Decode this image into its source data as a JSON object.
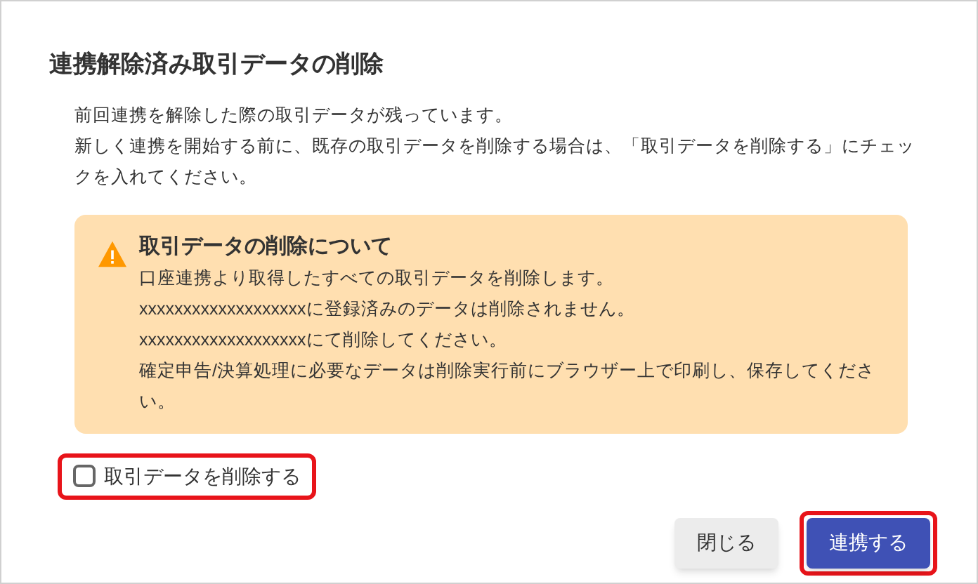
{
  "dialog": {
    "title": "連携解除済み取引データの削除",
    "message": [
      "前回連携を解除した際の取引データが残っています。",
      "新しく連携を開始する前に、既存の取引データを削除する場合は、「取引データを削除する」にチェックを入れてください。"
    ],
    "alert": {
      "title": "取引データの削除について",
      "lines": [
        "口座連携より取得したすべての取引データを削除します。",
        "xxxxxxxxxxxxxxxxxxxに登録済みのデータは削除されません。",
        "xxxxxxxxxxxxxxxxxxxにて削除してください。",
        "確定申告/決算処理に必要なデータは削除実行前にブラウザー上で印刷し、保存してください。"
      ]
    },
    "checkbox": {
      "label": "取引データを削除する",
      "checked": false,
      "highlighted": true
    },
    "buttons": [
      {
        "label": "閉じる",
        "kind": "secondary",
        "highlighted": false
      },
      {
        "label": "連携する",
        "kind": "primary",
        "highlighted": true
      }
    ]
  }
}
